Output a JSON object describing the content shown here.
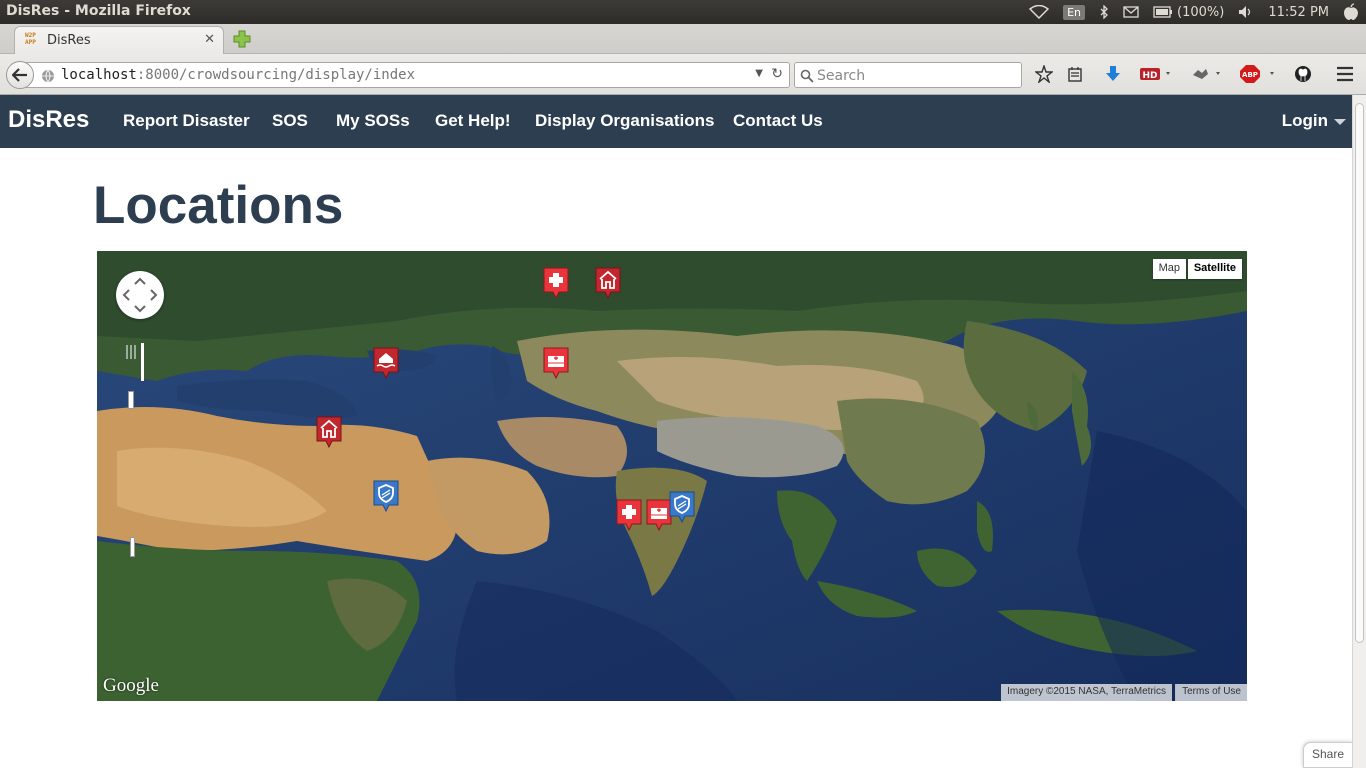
{
  "os": {
    "window_title": "DisRes - Mozilla Firefox",
    "language": "En",
    "battery": "(100%)",
    "clock": "11:52 PM",
    "icons": [
      "wifi-icon",
      "bluetooth-icon",
      "mail-icon",
      "battery-icon",
      "volume-icon",
      "apple-icon"
    ]
  },
  "browser": {
    "tab": {
      "label": "DisRes",
      "favicon": "W2P APP"
    },
    "address": {
      "host": "localhost",
      "rest": ":8000/crowdsourcing/display/index"
    },
    "search": {
      "placeholder": "Search"
    },
    "toolbar_icons": [
      "bookmark-star-icon",
      "reading-list-icon",
      "download-icon",
      "hd-icon",
      "extension-icon",
      "adblock-icon",
      "github-icon",
      "menu-icon"
    ],
    "adblock_label": "ABP",
    "hd_label": "HD"
  },
  "navbar": {
    "brand": "DisRes",
    "links": [
      "Report Disaster",
      "SOS",
      "My SOSs",
      "Get Help!",
      "Display Organisations",
      "Contact Us"
    ],
    "login": "Login"
  },
  "page": {
    "title": "Locations"
  },
  "map": {
    "type_buttons": [
      "Map",
      "Satellite"
    ],
    "active_type": "Satellite",
    "logo": "Google",
    "attribution": "Imagery ©2015 NASA, TerraMetrics",
    "terms": "Terms of Use",
    "markers": [
      {
        "kind": "hospital",
        "color": "#e8343a"
      },
      {
        "kind": "shelter",
        "color": "#c0282e"
      },
      {
        "kind": "flood",
        "color": "#c0282e"
      },
      {
        "kind": "clinic",
        "color": "#e8343a"
      },
      {
        "kind": "shelter",
        "color": "#c0282e"
      },
      {
        "kind": "police",
        "color": "#3a78c9"
      },
      {
        "kind": "hospital",
        "color": "#e8343a"
      },
      {
        "kind": "clinic",
        "color": "#e8343a"
      },
      {
        "kind": "police",
        "color": "#3a78c9"
      }
    ]
  },
  "share": {
    "label": "Share"
  }
}
